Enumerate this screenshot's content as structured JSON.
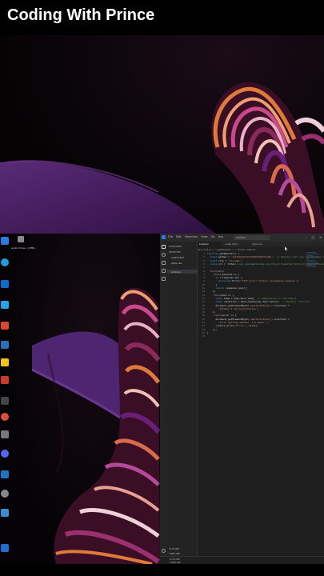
{
  "header": {
    "title": "Coding With Prince"
  },
  "desktop": {
    "top_label": "ayde mmes.. ((XMI)..",
    "icons": [
      {
        "name": "app-icon",
        "color": "#2d7be0"
      },
      {
        "name": "app-icon",
        "color": "#1a9fd8"
      },
      {
        "name": "app-icon",
        "color": "#0d6cc9"
      },
      {
        "name": "app-icon",
        "color": "#22a3ea"
      },
      {
        "name": "app-icon",
        "color": "#d9472b"
      },
      {
        "name": "app-icon",
        "color": "#2a6fb3"
      },
      {
        "name": "app-icon",
        "color": "#f0c419"
      },
      {
        "name": "app-icon",
        "color": "#c83a2a"
      },
      {
        "name": "app-icon",
        "color": "#444444"
      },
      {
        "name": "app-icon",
        "color": "#e04c3c"
      },
      {
        "name": "app-icon",
        "color": "#777777"
      },
      {
        "name": "app-icon",
        "color": "#5865f2"
      },
      {
        "name": "app-icon",
        "color": "#1b75bc"
      },
      {
        "name": "app-icon",
        "color": "#888888"
      },
      {
        "name": "app-icon",
        "color": "#3b8ed0"
      },
      {
        "name": "app-icon",
        "color": "#1f6fd0"
      }
    ]
  },
  "editor": {
    "menu": [
      "File",
      "Edit",
      "Selection",
      "View",
      "Go",
      "Run"
    ],
    "search": "Weather",
    "sidebar": {
      "header": "EXPLORER",
      "section": "WEATHER",
      "items": [
        "index.html",
        "style.css",
        "script.js"
      ],
      "outline": "OUTLINE",
      "timeline": "TIMELINE"
    },
    "tabs": [
      "script.js",
      "index.html",
      "style.css"
    ],
    "breadcrumb": "JS script.js > ☉ getWeather > ☉ then() callback",
    "code_lines": [
      "function getWeather() {",
      "  const apiKey = 'a1f4e91d0c2bf3ad9d7e82c61a0e';  // Replace with your OpenWeather API key",
      "  const city = 'Chicago';",
      "  const url = `https://api.openweathermap.org/data/2.5/weather?q=${city}&appid=${apiKey}&units=imperial`;",
      "",
      "  fetch(url)",
      "    .then(response => {",
      "      if (!response.ok) {",
      "        throw new Error(`HTTP error! Status: ${response.status}`);",
      "      }",
      "      return response.json();",
      "    })",
      "    .then(data => {",
      "      const temp = data.main.temp;  // Temperature in Fahrenheit",
      "      const condition = data.weather[0].description;  // Weather condition",
      "      document.getElementById('weatherDisplay').innerText =",
      "        `${temp}°F and ${condition}`;",
      "    })",
      "    .catch(error => {",
      "      document.getElementById('weatherDisplay').innerText =",
      "        'Error getting weather. Try again.';",
      "      console.error('Error:', error);",
      "    });",
      "}",
      ""
    ],
    "status": {
      "outline": "OUTLINE",
      "timeline": "TIMELINE"
    }
  },
  "colors": {
    "keyword": "#569cd6",
    "control": "#c586c0",
    "string": "#ce9178",
    "function": "#dcdcaa",
    "variable": "#9cdcfe",
    "comment": "#6a9955"
  }
}
